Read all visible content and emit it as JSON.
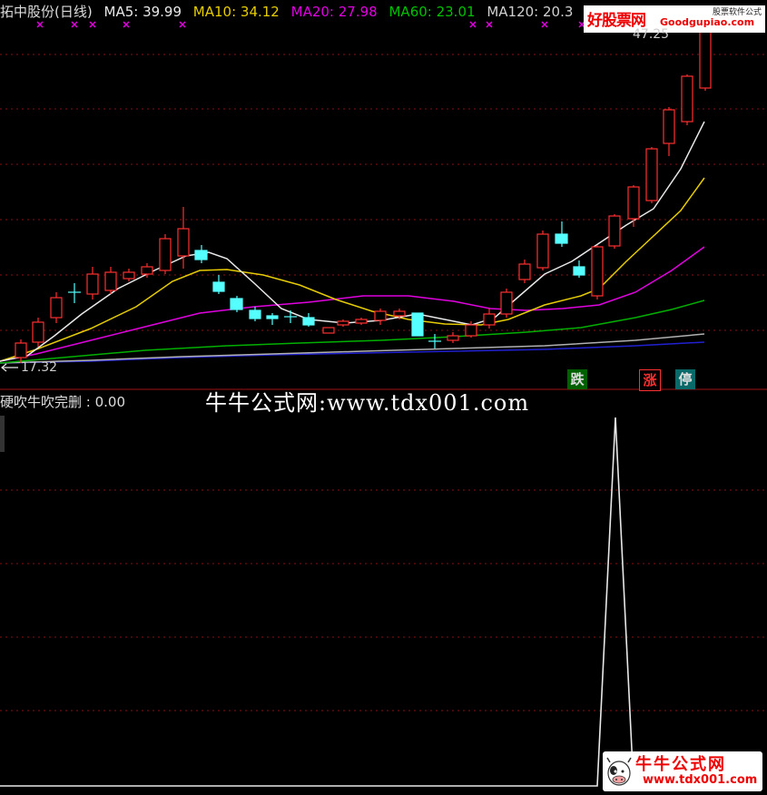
{
  "header": {
    "stock_title": "拓中股份(日线)",
    "ma5": "MA5: 39.99",
    "ma10": "MA10: 34.12",
    "ma20": "MA20: 27.98",
    "ma60": "MA60: 23.01",
    "ma120": "MA120: 20.3"
  },
  "colors": {
    "ma5": "#e8e8e8",
    "ma10": "#e6cc00",
    "ma20": "#e000e0",
    "ma60": "#00b000",
    "ma120": "#b0b0b0",
    "ma250": "#2020d0",
    "up": "#ff3030",
    "down": "#55ffff",
    "grid": "#8a1010"
  },
  "price_labels": {
    "high": "47.25",
    "low": "17.32"
  },
  "badges": {
    "die": "跌",
    "zhang": "涨",
    "ting": "停"
  },
  "indicator": {
    "title": "硬吹牛吹完删 : 0.00"
  },
  "watermarks": {
    "top_brand": "好股票网",
    "top_url": "Goodgupiao.com",
    "top_small": "股票软件公式",
    "center": "牛牛公式网:www.tdx001.com",
    "bottom_title": "牛牛公式网",
    "bottom_url": "www.tdx001.com"
  },
  "icons": {
    "arrow": "left-arrow-icon",
    "marker": "magenta-x-marker-icon",
    "mascot": "cow-mascot-icon"
  }
}
